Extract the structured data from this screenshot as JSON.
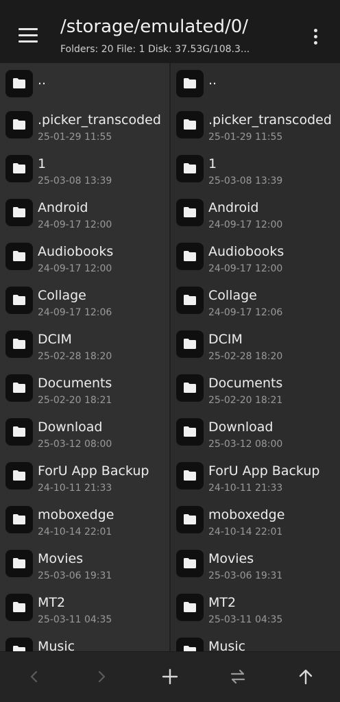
{
  "header": {
    "path": "/storage/emulated/0/",
    "stats": "Folders: 20  File: 1  Disk: 37.53G/108.3..."
  },
  "entries": [
    {
      "name": "..",
      "date": ""
    },
    {
      "name": ".picker_transcoded",
      "date": "25-01-29 11:55"
    },
    {
      "name": "1",
      "date": "25-03-08 13:39"
    },
    {
      "name": "Android",
      "date": "24-09-17 12:00"
    },
    {
      "name": "Audiobooks",
      "date": "24-09-17 12:00"
    },
    {
      "name": "Collage",
      "date": "24-09-17 12:06"
    },
    {
      "name": "DCIM",
      "date": "25-02-28 18:20"
    },
    {
      "name": "Documents",
      "date": "25-02-20 18:21"
    },
    {
      "name": "Download",
      "date": "25-03-12 08:00"
    },
    {
      "name": "ForU App Backup",
      "date": "24-10-11 21:33"
    },
    {
      "name": "moboxedge",
      "date": "24-10-14 22:01"
    },
    {
      "name": "Movies",
      "date": "25-03-06 19:31"
    },
    {
      "name": "MT2",
      "date": "25-03-11 04:35"
    },
    {
      "name": "Music",
      "date": ""
    }
  ],
  "toolbar": {
    "icons": [
      "chevron-left-icon",
      "chevron-right-icon",
      "plus-icon",
      "swap-icon",
      "arrow-up-icon"
    ]
  },
  "colors": {
    "header_bg": "#1b1b1b",
    "pane_bg": "#303030",
    "icon_tile": "#0f0f0f",
    "folder_icon": "#f0f0f0",
    "date_text": "#9a9a9a"
  }
}
